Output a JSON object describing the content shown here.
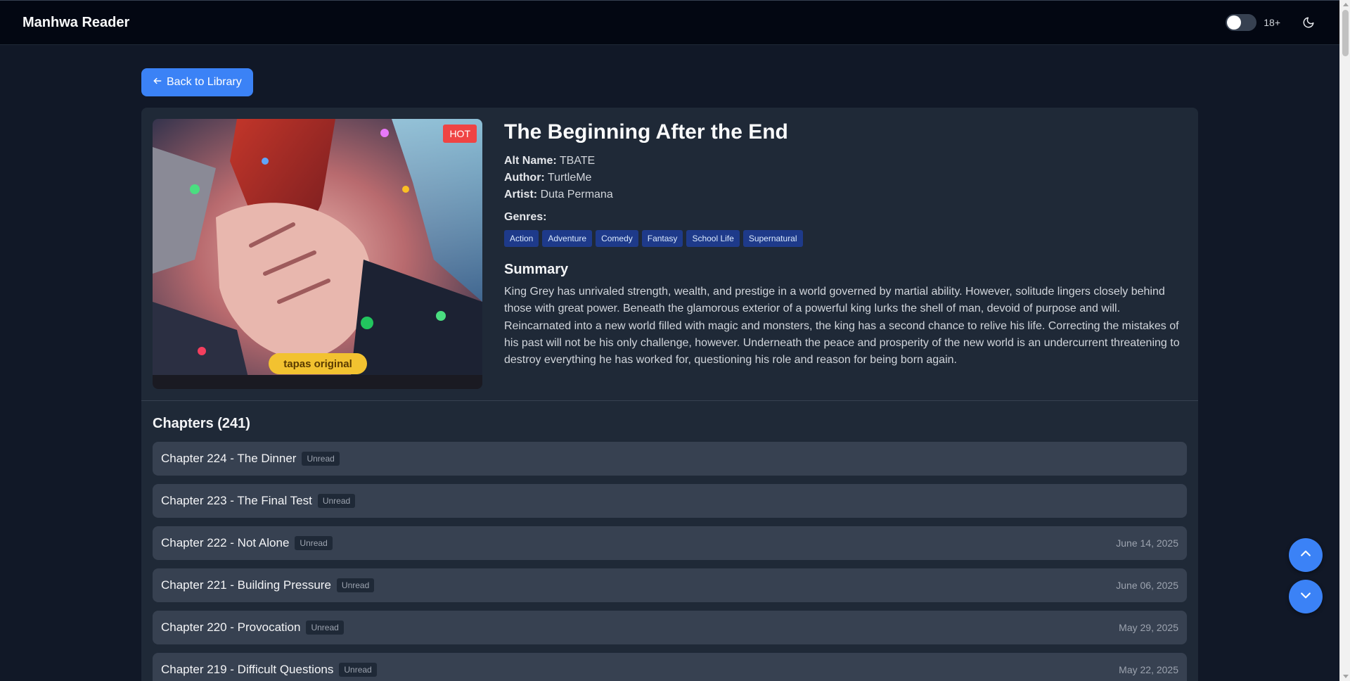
{
  "header": {
    "brand": "Manhwa Reader",
    "age_filter_label": "18+",
    "age_filter_enabled": false
  },
  "nav": {
    "back_label": "Back to Library"
  },
  "manga": {
    "badge": "HOT",
    "cover_text": "tapas original",
    "title": "The Beginning After the End",
    "alt_name_key": "Alt Name:",
    "alt_name": "TBATE",
    "author_key": "Author:",
    "author": "TurtleMe",
    "artist_key": "Artist:",
    "artist": "Duta Permana",
    "genres_label": "Genres:",
    "genres": [
      "Action",
      "Adventure",
      "Comedy",
      "Fantasy",
      "School Life",
      "Supernatural"
    ],
    "summary_title": "Summary",
    "summary": "King Grey has unrivaled strength, wealth, and prestige in a world governed by martial ability. However, solitude lingers closely behind those with great power. Beneath the glamorous exterior of a powerful king lurks the shell of man, devoid of purpose and will. Reincarnated into a new world filled with magic and monsters, the king has a second chance to relive his life. Correcting the mistakes of his past will not be his only challenge, however. Underneath the peace and prosperity of the new world is an undercurrent threatening to destroy everything he has worked for, questioning his role and reason for being born again."
  },
  "chapters": {
    "title": "Chapters (241)",
    "items": [
      {
        "name": "Chapter 224 - The Dinner",
        "status": "Unread",
        "date": ""
      },
      {
        "name": "Chapter 223 - The Final Test",
        "status": "Unread",
        "date": ""
      },
      {
        "name": "Chapter 222 - Not Alone",
        "status": "Unread",
        "date": "June 14, 2025"
      },
      {
        "name": "Chapter 221 - Building Pressure",
        "status": "Unread",
        "date": "June 06, 2025"
      },
      {
        "name": "Chapter 220 - Provocation",
        "status": "Unread",
        "date": "May 29, 2025"
      },
      {
        "name": "Chapter 219 - Difficult Questions",
        "status": "Unread",
        "date": "May 22, 2025"
      }
    ]
  },
  "icons": {
    "back": "arrow-left-icon",
    "theme": "moon-icon",
    "scroll_up": "chevron-up-icon",
    "scroll_down": "chevron-down-icon"
  },
  "colors": {
    "background": "#111827",
    "header": "#030712",
    "card": "#1f2937",
    "row": "#374151",
    "accent": "#3b82f6",
    "hot": "#ef4444",
    "genre": "#1e3a8a"
  }
}
